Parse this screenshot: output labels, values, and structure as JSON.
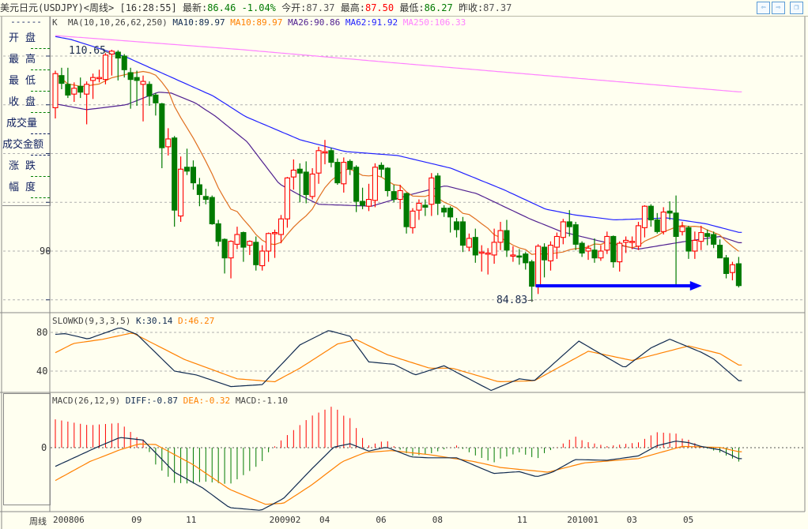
{
  "header": {
    "symbol": "美元日元(USDJPY)<周线>",
    "time": "[16:28:55]",
    "latest_label": "最新:",
    "latest": "86.46",
    "change_pct": "-1.04%",
    "open_label": "今开:",
    "open": "87.37",
    "high_label": "最高:",
    "high": "87.50",
    "low_label": "最低:",
    "low": "86.27",
    "prev_close_label": "昨收:",
    "prev_close": "87.37",
    "nav": {
      "prev": "⇦",
      "next": "⇨",
      "restore": "❐"
    }
  },
  "sidebar": {
    "dash": "------",
    "items": [
      "开盘",
      "最高",
      "最低",
      "收盘",
      "成交量",
      "成交金额",
      "涨跌",
      "幅度"
    ]
  },
  "legend_main": {
    "k": "K",
    "ma": "MA(10,10,26,62,250)",
    "ma10a": "MA10:89.97",
    "ma10b": "MA10:89.97",
    "ma26": "MA26:90.86",
    "ma62": "MA62:91.92",
    "ma250": "MA250:106.33"
  },
  "legend_kd": {
    "name": "SLOWKD(9,3,3,5)",
    "k": "K:30.14",
    "d": "D:46.27"
  },
  "legend_macd": {
    "name": "MACD(26,12,9)",
    "diff": "DIFF:-0.87",
    "dea": "DEA:-0.32",
    "macd": "MACD:-1.10"
  },
  "annotations": {
    "high": "110.65",
    "low": "84.83",
    "arrow": "→"
  },
  "colors": {
    "up": "#ff0000",
    "down": "#007a00",
    "ma10": "#e07020",
    "ma26": "#502090",
    "ma62": "#2020ff",
    "ma250": "#ff80ff",
    "k": "#102a50",
    "d": "#ff8000",
    "bg": "#fffff0"
  },
  "chart_data": {
    "type": "candlestick",
    "period": "weekly",
    "price_axis": {
      "ticks": [
        "90"
      ],
      "grid": [
        85,
        90,
        95,
        100,
        105,
        110
      ]
    },
    "x_labels": [
      {
        "i": 0,
        "t": "200806"
      },
      {
        "i": 12.5,
        "t": "09"
      },
      {
        "i": 21.2,
        "t": "11"
      },
      {
        "i": 34.5,
        "t": "200902"
      },
      {
        "i": 42.5,
        "t": "04"
      },
      {
        "i": 51.5,
        "t": "06"
      },
      {
        "i": 60.5,
        "t": "08"
      },
      {
        "i": 74,
        "t": "11"
      },
      {
        "i": 82,
        "t": "201001"
      },
      {
        "i": 91.5,
        "t": "03"
      },
      {
        "i": 100.5,
        "t": "05"
      }
    ],
    "period_label": "周线",
    "candles_ohlc": [
      [
        104.7,
        108.5,
        103.6,
        108.2
      ],
      [
        108.0,
        108.8,
        106.6,
        107.2
      ],
      [
        107.1,
        108.8,
        105.7,
        106.0
      ],
      [
        106.1,
        107.3,
        105.3,
        106.7
      ],
      [
        106.9,
        107.8,
        105.7,
        106.3
      ],
      [
        106.1,
        107.4,
        103.0,
        107.1
      ],
      [
        107.5,
        108.2,
        105.6,
        107.8
      ],
      [
        107.8,
        108.6,
        107.3,
        107.8
      ],
      [
        107.6,
        110.3,
        107.1,
        110.1
      ],
      [
        110.2,
        110.65,
        108.0,
        110.5
      ],
      [
        110.4,
        110.6,
        107.5,
        109.8
      ],
      [
        110.0,
        110.2,
        107.8,
        108.6
      ],
      [
        108.3,
        108.8,
        104.6,
        107.6
      ],
      [
        107.8,
        108.5,
        104.9,
        107.5
      ],
      [
        107.1,
        108.0,
        103.3,
        107.4
      ],
      [
        107.1,
        107.4,
        104.9,
        105.9
      ],
      [
        106.0,
        106.2,
        103.9,
        105.2
      ],
      [
        105.1,
        105.2,
        98.5,
        100.6
      ],
      [
        100.7,
        102.6,
        99.8,
        101.5
      ],
      [
        101.6,
        101.8,
        92.5,
        94.2
      ],
      [
        93.6,
        99.7,
        93.0,
        98.4
      ],
      [
        98.6,
        100.5,
        97.8,
        98.2
      ],
      [
        98.6,
        99.3,
        96.3,
        97.0
      ],
      [
        96.8,
        97.5,
        94.6,
        95.8
      ],
      [
        95.6,
        96.4,
        94.8,
        95.3
      ],
      [
        95.5,
        95.7,
        92.7,
        92.8
      ],
      [
        92.8,
        93.2,
        90.5,
        91.0
      ],
      [
        91.2,
        91.3,
        87.7,
        89.3
      ],
      [
        89.3,
        91.1,
        87.2,
        91.0
      ],
      [
        90.7,
        92.5,
        90.2,
        91.7
      ],
      [
        91.9,
        92.0,
        88.9,
        90.4
      ],
      [
        90.6,
        91.1,
        89.6,
        91.0
      ],
      [
        90.9,
        91.5,
        88.0,
        88.6
      ],
      [
        88.5,
        90.6,
        88.0,
        90.0
      ],
      [
        90.0,
        91.9,
        88.9,
        91.8
      ],
      [
        91.8,
        92.2,
        89.3,
        91.9
      ],
      [
        91.7,
        93.7,
        90.8,
        93.3
      ],
      [
        93.3,
        97.6,
        92.4,
        97.5
      ],
      [
        97.6,
        99.4,
        96.3,
        98.3
      ],
      [
        98.4,
        99.0,
        95.0,
        98.0
      ],
      [
        98.1,
        99.2,
        94.9,
        95.8
      ],
      [
        95.6,
        98.5,
        95.3,
        97.9
      ],
      [
        98.0,
        100.7,
        96.9,
        100.3
      ],
      [
        100.2,
        101.4,
        98.9,
        100.2
      ],
      [
        100.3,
        100.6,
        98.6,
        99.1
      ],
      [
        99.1,
        99.5,
        96.8,
        97.0
      ],
      [
        96.9,
        99.6,
        96.0,
        99.1
      ],
      [
        99.2,
        99.4,
        97.8,
        98.4
      ],
      [
        98.6,
        98.8,
        94.0,
        95.1
      ],
      [
        95.1,
        96.5,
        94.3,
        94.7
      ],
      [
        94.6,
        96.9,
        94.1,
        95.3
      ],
      [
        95.2,
        99.0,
        94.5,
        98.6
      ],
      [
        98.8,
        99.1,
        97.6,
        98.4
      ],
      [
        98.5,
        98.6,
        95.6,
        96.2
      ],
      [
        96.1,
        96.8,
        95.0,
        95.3
      ],
      [
        95.3,
        96.8,
        94.3,
        96.2
      ],
      [
        95.9,
        96.0,
        91.8,
        92.5
      ],
      [
        92.4,
        94.4,
        91.8,
        94.1
      ],
      [
        94.2,
        95.3,
        93.2,
        94.9
      ],
      [
        94.7,
        95.3,
        93.6,
        94.5
      ],
      [
        94.8,
        98.0,
        93.6,
        97.5
      ],
      [
        97.7,
        98.0,
        93.7,
        94.9
      ],
      [
        94.4,
        94.7,
        93.5,
        94.0
      ],
      [
        94.4,
        94.6,
        91.9,
        93.5
      ],
      [
        93.0,
        93.4,
        91.4,
        92.2
      ],
      [
        93.0,
        93.5,
        89.9,
        90.6
      ],
      [
        90.4,
        91.8,
        90.0,
        91.3
      ],
      [
        91.4,
        92.3,
        88.8,
        89.6
      ],
      [
        89.8,
        90.6,
        87.9,
        89.9
      ],
      [
        89.7,
        90.3,
        87.6,
        89.8
      ],
      [
        89.6,
        92.3,
        88.7,
        90.9
      ],
      [
        90.9,
        93.0,
        90.1,
        92.1
      ],
      [
        92.1,
        93.2,
        89.4,
        90.1
      ],
      [
        89.5,
        90.5,
        88.9,
        89.6
      ],
      [
        89.5,
        90.2,
        88.6,
        89.4
      ],
      [
        89.7,
        89.9,
        88.1,
        88.8
      ],
      [
        88.9,
        89.1,
        84.83,
        86.4
      ],
      [
        86.4,
        90.7,
        85.6,
        90.5
      ],
      [
        90.4,
        90.8,
        87.3,
        89.1
      ],
      [
        89.0,
        91.0,
        88.0,
        90.6
      ],
      [
        90.4,
        91.9,
        89.2,
        91.5
      ],
      [
        91.4,
        93.3,
        90.7,
        93.0
      ],
      [
        93.0,
        94.2,
        91.5,
        92.5
      ],
      [
        92.7,
        93.0,
        90.1,
        90.7
      ],
      [
        90.8,
        91.0,
        89.4,
        89.8
      ],
      [
        90.0,
        90.6,
        89.1,
        90.3
      ],
      [
        90.1,
        91.3,
        88.8,
        89.3
      ],
      [
        89.3,
        90.6,
        89.0,
        90.0
      ],
      [
        90.1,
        92.0,
        89.7,
        91.5
      ],
      [
        91.5,
        91.6,
        88.3,
        88.9
      ],
      [
        88.9,
        91.0,
        87.9,
        90.8
      ],
      [
        90.9,
        91.5,
        89.8,
        91.1
      ],
      [
        91.0,
        91.5,
        90.2,
        91.0
      ],
      [
        90.5,
        93.0,
        90.1,
        92.6
      ],
      [
        92.4,
        94.7,
        91.4,
        94.6
      ],
      [
        94.6,
        94.8,
        92.5,
        93.2
      ],
      [
        93.2,
        93.9,
        91.8,
        92.0
      ],
      [
        92.0,
        94.5,
        91.7,
        94.0
      ],
      [
        94.1,
        95.1,
        93.2,
        93.9
      ],
      [
        93.9,
        95.7,
        86.3,
        91.5
      ],
      [
        92.0,
        93.0,
        91.6,
        92.5
      ],
      [
        92.4,
        92.6,
        89.2,
        90.0
      ],
      [
        90.0,
        92.0,
        89.2,
        91.1
      ],
      [
        91.0,
        92.6,
        90.1,
        91.9
      ],
      [
        91.8,
        92.2,
        90.6,
        91.5
      ],
      [
        91.7,
        92.0,
        90.3,
        90.7
      ],
      [
        90.6,
        91.2,
        89.3,
        89.3
      ],
      [
        89.3,
        89.6,
        87.2,
        87.7
      ],
      [
        87.8,
        88.9,
        87.0,
        88.6
      ],
      [
        88.7,
        89.4,
        86.27,
        86.46
      ]
    ],
    "ma26_keyframes": [
      [
        0,
        105.1
      ],
      [
        5,
        104.5
      ],
      [
        11.3,
        105
      ],
      [
        16.4,
        106.3
      ],
      [
        18.5,
        106.2
      ],
      [
        22.3,
        105.2
      ],
      [
        25.6,
        103.8
      ],
      [
        30.6,
        101.2
      ],
      [
        35.7,
        96.9
      ],
      [
        39.1,
        95.7
      ],
      [
        42,
        94.8
      ],
      [
        50.4,
        94.6
      ],
      [
        56.7,
        95.8
      ],
      [
        62.2,
        96.7
      ],
      [
        67.2,
        95.9
      ],
      [
        75.7,
        93.3
      ],
      [
        80.7,
        92.0
      ],
      [
        87,
        91.0
      ],
      [
        93,
        90.2
      ],
      [
        99.6,
        90.9
      ],
      [
        106,
        91.5
      ],
      [
        109,
        90.86
      ]
    ],
    "ma62_keyframes": [
      [
        0,
        112.0
      ],
      [
        2.5,
        111.7
      ],
      [
        11.3,
        109.9
      ],
      [
        25.2,
        105.9
      ],
      [
        30.3,
        103.8
      ],
      [
        39.1,
        101.4
      ],
      [
        46.3,
        100.2
      ],
      [
        54.6,
        99.8
      ],
      [
        63.1,
        98.5
      ],
      [
        71.5,
        96.3
      ],
      [
        78.2,
        94.3
      ],
      [
        82.9,
        93.7
      ],
      [
        89.2,
        93.2
      ],
      [
        97.5,
        93.4
      ],
      [
        103.8,
        92.8
      ],
      [
        109,
        91.92
      ]
    ],
    "ma250_keyframes": [
      [
        0,
        112.1
      ],
      [
        29,
        110.7
      ],
      [
        54.2,
        109.3
      ],
      [
        109,
        106.33
      ]
    ],
    "kd": {
      "ticks": [
        "80",
        "40"
      ],
      "k_keyframes": [
        [
          0,
          78
        ],
        [
          1.6,
          78.7
        ],
        [
          5.2,
          73.2
        ],
        [
          10.3,
          85
        ],
        [
          13,
          78
        ],
        [
          19,
          40
        ],
        [
          22.5,
          36
        ],
        [
          28,
          24
        ],
        [
          33,
          26
        ],
        [
          39,
          67
        ],
        [
          43.6,
          82
        ],
        [
          47,
          76
        ],
        [
          50,
          49.5
        ],
        [
          54,
          47
        ],
        [
          57.4,
          36
        ],
        [
          62,
          45.5
        ],
        [
          69.5,
          20
        ],
        [
          74,
          32
        ],
        [
          76.4,
          30
        ],
        [
          83.5,
          71
        ],
        [
          90.8,
          43.5
        ],
        [
          95,
          64
        ],
        [
          98,
          73
        ],
        [
          103,
          59.5
        ],
        [
          105,
          52.6
        ],
        [
          109,
          30.14
        ]
      ],
      "d_keyframes": [
        [
          0,
          59
        ],
        [
          2.9,
          68.6
        ],
        [
          7.4,
          72.7
        ],
        [
          12.3,
          79.5
        ],
        [
          20.6,
          52
        ],
        [
          29,
          32
        ],
        [
          35,
          29
        ],
        [
          39,
          43
        ],
        [
          45,
          68
        ],
        [
          48,
          72.5
        ],
        [
          53,
          56.8
        ],
        [
          59.7,
          43
        ],
        [
          63.3,
          43
        ],
        [
          70.7,
          29
        ],
        [
          76.4,
          30
        ],
        [
          85,
          60.5
        ],
        [
          92,
          51
        ],
        [
          101,
          66
        ],
        [
          106,
          58
        ],
        [
          109,
          46.27
        ]
      ]
    },
    "macd": {
      "ticks": [
        "0"
      ],
      "diff_keyframes": [
        [
          0,
          -1.48
        ],
        [
          6.2,
          -0.06
        ],
        [
          10.3,
          0.81
        ],
        [
          14,
          0.6
        ],
        [
          19,
          -1.94
        ],
        [
          23.5,
          -3.19
        ],
        [
          27.8,
          -4.75
        ],
        [
          32.8,
          -4.96
        ],
        [
          36.4,
          -4.02
        ],
        [
          40.8,
          -1.73
        ],
        [
          44.4,
          0.04
        ],
        [
          47,
          0.31
        ],
        [
          50,
          -0.27
        ],
        [
          52.8,
          0.04
        ],
        [
          56.8,
          -0.73
        ],
        [
          59.6,
          -0.8
        ],
        [
          64,
          -0.8
        ],
        [
          69.9,
          -2.04
        ],
        [
          74,
          -1.9
        ],
        [
          76.8,
          -2.3
        ],
        [
          79.3,
          -1.94
        ],
        [
          82.9,
          -0.94
        ],
        [
          88,
          -1.0
        ],
        [
          93,
          -0.65
        ],
        [
          95.9,
          0.15
        ],
        [
          99,
          0.52
        ],
        [
          101,
          0.4
        ],
        [
          103,
          0.1
        ],
        [
          106,
          -0.17
        ],
        [
          109,
          -0.87
        ]
      ],
      "dea_keyframes": [
        [
          0,
          -2.6
        ],
        [
          5.5,
          -1.1
        ],
        [
          10.3,
          -0.17
        ],
        [
          13.3,
          0.29
        ],
        [
          16,
          0.25
        ],
        [
          21.9,
          -1.32
        ],
        [
          27.8,
          -3.3
        ],
        [
          33.5,
          -4.48
        ],
        [
          36.4,
          -4.4
        ],
        [
          40.8,
          -2.98
        ],
        [
          45.8,
          -1.1
        ],
        [
          49.4,
          -0.38
        ],
        [
          53.6,
          -0.23
        ],
        [
          59.6,
          -0.55
        ],
        [
          66.8,
          -1.1
        ],
        [
          71,
          -1.57
        ],
        [
          78.6,
          -1.94
        ],
        [
          84.3,
          -1.21
        ],
        [
          93,
          -0.86
        ],
        [
          100,
          0.1
        ],
        [
          106,
          0.02
        ],
        [
          109,
          -0.32
        ]
      ]
    },
    "trend_arrow": {
      "from_index": 77,
      "to_index": 103,
      "price": 86.6
    }
  }
}
